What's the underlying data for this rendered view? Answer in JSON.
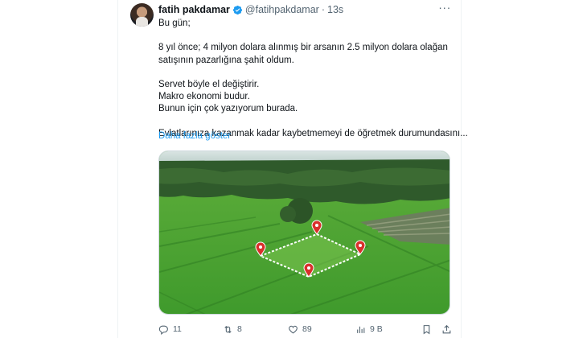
{
  "tweet": {
    "author_name": "fatih pakdamar",
    "handle": "@fatihpakdamar",
    "separator": "·",
    "time": "13s",
    "lines": [
      "Bu gün;",
      "",
      "8 yıl önce; 4 milyon dolara alınmış bir arsanın 2.5 milyon dolara olağan",
      "satışının pazarlığına şahit oldum.",
      "",
      "Servet böyle el değiştirir.",
      "Makro ekonomi budur.",
      "Bunun için çok yazıyorum burada.",
      "",
      "Evlatlarınıza kazanmak kadar kaybetmemeyi de öğretmek durumundasını..."
    ],
    "show_more": "Daha fazla göster",
    "media_icon": "aerial-farmland-photo"
  },
  "actions": {
    "replies": "11",
    "retweets": "8",
    "likes": "89",
    "views": "9 B"
  },
  "colors": {
    "accent": "#1d9bf0",
    "muted": "#536471",
    "verified": "#1d9bf0"
  }
}
